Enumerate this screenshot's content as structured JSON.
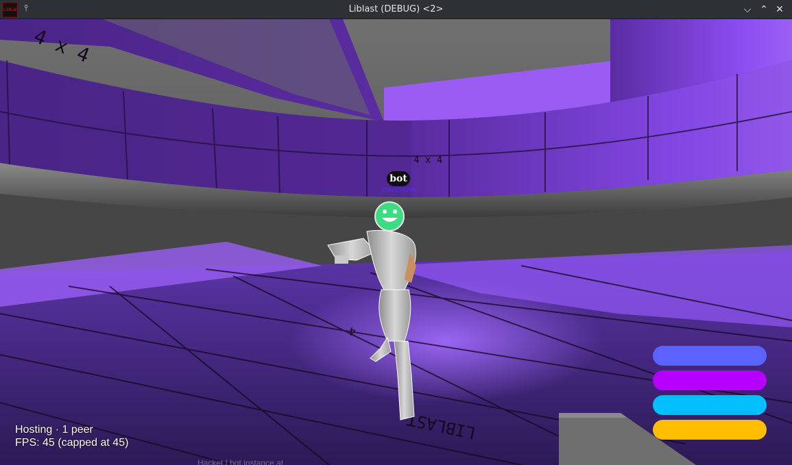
{
  "window": {
    "title": "Liblast (DEBUG) <2>",
    "app_icon_text": "LIBLAST"
  },
  "hud": {
    "status_line": "Hosting · 1 peer",
    "fps_line": "FPS: 45 (capped at 45)",
    "bars": [
      {
        "name": "bar-1",
        "color": "#5b63ff"
      },
      {
        "name": "bar-2",
        "color": "#b500ff"
      },
      {
        "name": "bar-3",
        "color": "#00bfff"
      },
      {
        "name": "bar-4",
        "color": "#ffbf00"
      }
    ]
  },
  "player": {
    "name": "bot",
    "id": "1362054035",
    "face_color": "#3ddc84"
  },
  "scene": {
    "wall_color": "#7b3ad6",
    "floor_color": "#3a2466",
    "wall_markings": [
      "4 x 4",
      "4 x 4",
      "4 x 4"
    ],
    "floor_text": "LIBLAST",
    "floor_small": "4"
  },
  "chat": {
    "ghost_text": "Hacket | bot instance at"
  },
  "icons": {
    "pin": "pin-icon",
    "minimize": "chevron-down-icon",
    "maximize": "chevron-up-icon",
    "close": "close-icon"
  }
}
